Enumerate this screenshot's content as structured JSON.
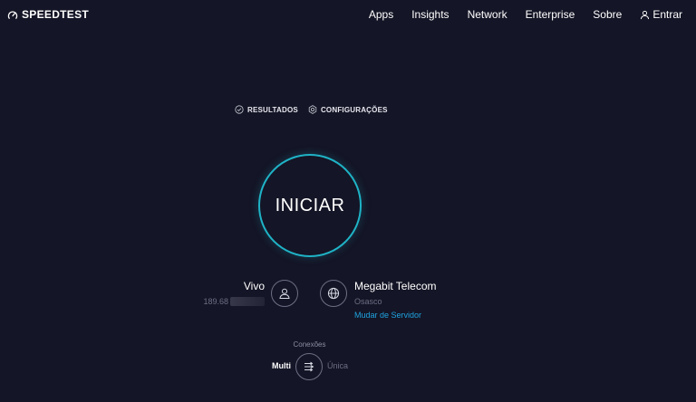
{
  "brand": {
    "name": "SPEEDTEST",
    "icon": "speedometer-icon"
  },
  "nav": {
    "items": [
      "Apps",
      "Insights",
      "Network",
      "Enterprise",
      "Sobre"
    ],
    "login_label": "Entrar",
    "login_icon": "user-icon"
  },
  "subtabs": {
    "results_label": "RESULTADOS",
    "results_icon": "check-circle-icon",
    "settings_label": "CONFIGURAÇÕES",
    "settings_icon": "gear-icon"
  },
  "start": {
    "label": "INICIAR",
    "ring_color": "#1fb3c6"
  },
  "isp": {
    "name": "Vivo",
    "ip_visible": "189.68",
    "icon": "user-icon"
  },
  "server": {
    "name": "Megabit Telecom",
    "location": "Osasco",
    "change_label": "Mudar de Servidor",
    "icon": "globe-icon"
  },
  "connections": {
    "label": "Conexões",
    "multi_label": "Multi",
    "single_label": "Única",
    "selected": "Multi",
    "icon": "connections-icon"
  },
  "colors": {
    "background": "#141526",
    "accent": "#1fb3c6",
    "link": "#1fa3e0",
    "muted": "#6d6f84"
  }
}
